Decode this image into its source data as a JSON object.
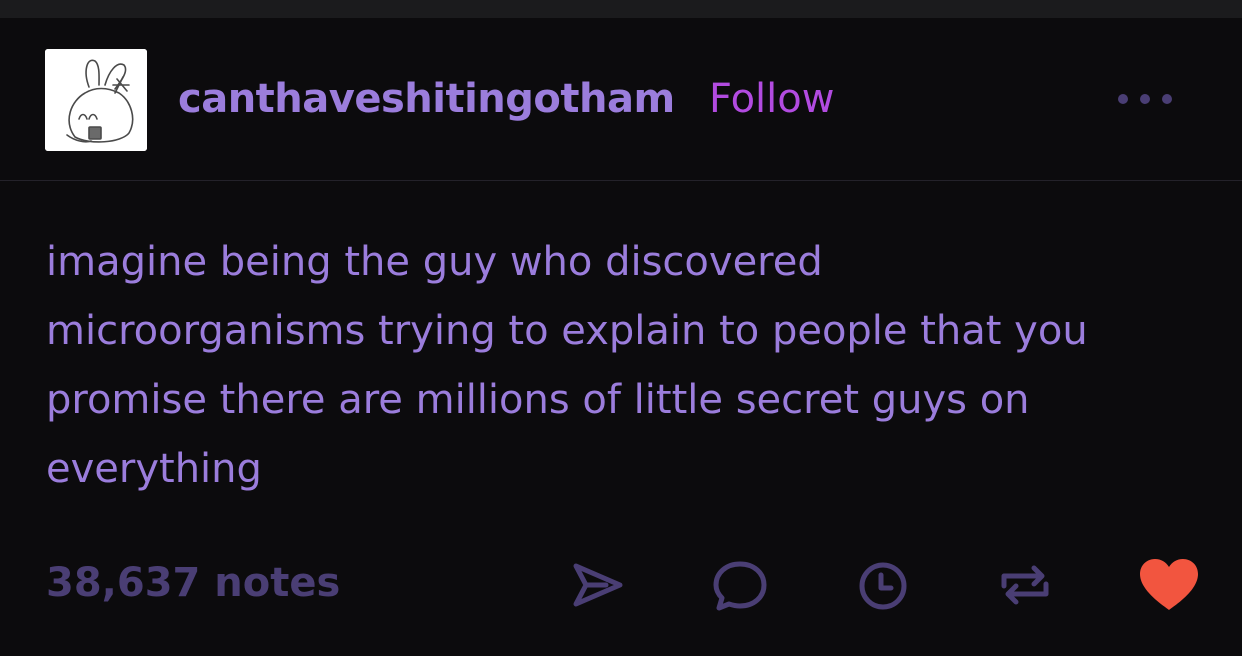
{
  "post": {
    "author": "canthaveshitingotham",
    "follow_label": "Follow",
    "text": "imagine being the guy who discovered\nmicroorganisms trying to explain to people that you\npromise there are millions of little secret guys on\neverything",
    "notes": "38,637 notes"
  },
  "icons": {
    "more": "more-options-icon",
    "share": "send-icon",
    "reply": "reply-icon",
    "queue": "clock-icon",
    "reblog": "reblog-icon",
    "like": "heart-icon"
  },
  "colors": {
    "background": "#0c0b0d",
    "text": "#9b7ddc",
    "follow": "#b24be0",
    "muted": "#4a3e74",
    "like": "#f2553f"
  }
}
